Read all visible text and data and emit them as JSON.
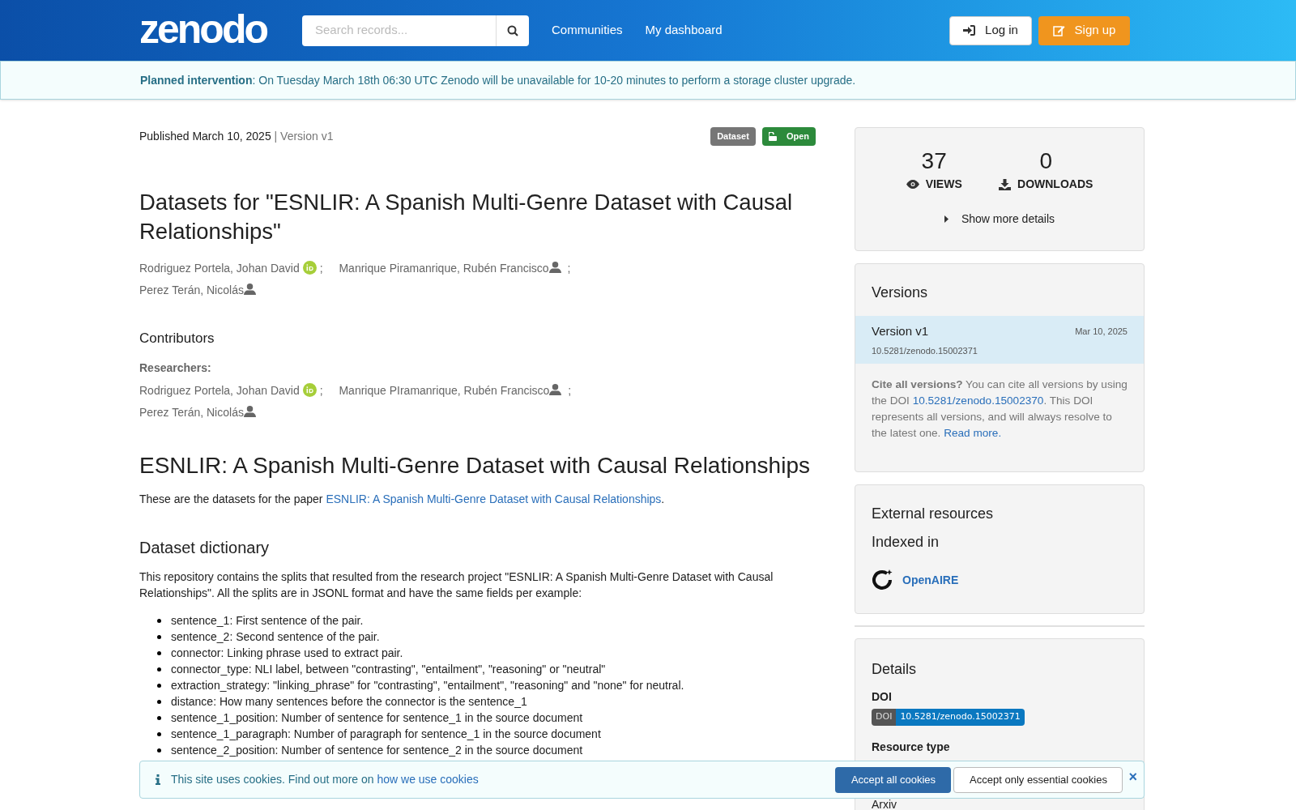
{
  "header": {
    "logo": "zenodo",
    "search": {
      "placeholder": "Search records..."
    },
    "nav": [
      "Communities",
      "My dashboard"
    ],
    "login": "Log in",
    "signup": "Sign up"
  },
  "notice": {
    "title": "Planned intervention",
    "text": ": On Tuesday March 18th 06:30 UTC Zenodo will be unavailable for 10-20 minutes to perform a storage cluster upgrade."
  },
  "record": {
    "published": "Published March 10, 2025",
    "version": "| Version v1",
    "badges": [
      {
        "kind": "type",
        "label": "Dataset"
      },
      {
        "kind": "access",
        "label": "Open"
      }
    ],
    "title": "Datasets for \"ESNLIR: A Spanish Multi-Genre Dataset with Causal Relationships\"",
    "creators": [
      {
        "name": "Rodriguez Portela, Johan David",
        "kind": "orcid",
        "sep": ";"
      },
      {
        "name": "Manrique Piramanrique, Rubén Francisco",
        "kind": "person",
        "sep": ";"
      },
      {
        "name": "Perez Terán, Nicolás",
        "kind": "person"
      }
    ],
    "contributors_heading": "Contributors",
    "role": "Researchers:",
    "contributors": [
      {
        "name": "Rodriguez Portela, Johan David",
        "kind": "orcid",
        "sep": ";"
      },
      {
        "name": "Manrique PIramanrique, Rubén Francisco",
        "kind": "person",
        "sep": ";"
      },
      {
        "name": "Perez Terán, Nicolás",
        "kind": "person"
      }
    ],
    "heading": "ESNLIR: A Spanish Multi-Genre Dataset with Causal Relationships",
    "intro": "These are the datasets for the paper ",
    "intro_link": "ESNLIR: A Spanish Multi-Genre Dataset with Causal Relationships",
    "intro_end": ".",
    "subheading": "Dataset dictionary",
    "paragraph": "This repository contains the splits that resulted from the research project \"ESNLIR: A Spanish Multi-Genre Dataset with Causal Relationships\". All the splits are in JSONL format and have the same fields per example:",
    "fields": [
      "sentence_1: First sentence of the pair.",
      "sentence_2: Second sentence of the pair.",
      "connector: Linking phrase used to extract pair.",
      "connector_type: NLI label, between \"contrasting\", \"entailment\", \"reasoning\" or \"neutral\"",
      "extraction_strategy: \"linking_phrase\" for \"contrasting\", \"entailment\", \"reasoning\" and \"none\" for neutral.",
      "distance: How many sentences before the connector is the sentence_1",
      "sentence_1_position: Number of sentence for sentence_1 in the source document",
      "sentence_1_paragraph: Number of paragraph for sentence_1 in the source document",
      "sentence_2_position: Number of sentence for sentence_2 in the source document"
    ]
  },
  "stats": {
    "views": "37",
    "views_label": "VIEWS",
    "downloads": "0",
    "downloads_label": "DOWNLOADS",
    "more": "Show more details"
  },
  "versions": {
    "title": "Versions",
    "items": [
      {
        "label": "Version v1",
        "date": "Mar 10, 2025",
        "doi": "10.5281/zenodo.15002371",
        "selected": true
      }
    ],
    "cite_bold": "Cite all versions?",
    "cite_1": " You can cite all versions by using the DOI ",
    "cite_link": "10.5281/zenodo.15002370",
    "cite_2": ". This DOI represents all versions, and will always resolve to the latest one. ",
    "read_more": "Read more."
  },
  "external": {
    "title": "External resources",
    "subtitle": "Indexed in",
    "link": "OpenAIRE"
  },
  "details": {
    "title": "Details",
    "doi_label": "DOI",
    "doi_tag": "DOI",
    "doi": "10.5281/zenodo.15002371",
    "type_label": "Resource type",
    "next": "Arxiv"
  },
  "cookies": {
    "text": "This site uses cookies. Find out more on ",
    "link": "how we use cookies",
    "accept_all": "Accept all cookies",
    "accept_essential": "Accept only essential cookies",
    "close": "×"
  }
}
